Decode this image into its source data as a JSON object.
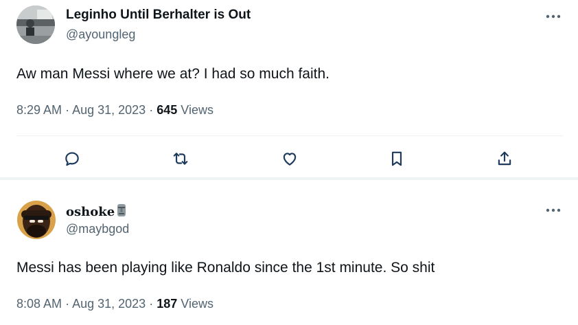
{
  "tweets": [
    {
      "author_name": "Leginho Until Berhalter is Out",
      "handle": "@ayoungleg",
      "text": "Aw man Messi where we at? I had so much faith.",
      "time": "8:29 AM",
      "date": "Aug 31, 2023",
      "views_count": "645",
      "views_label": "Views",
      "separator": "·",
      "more_icon": "more-horizontal-icon",
      "actions": [
        "reply-icon",
        "retweet-icon",
        "like-icon",
        "bookmark-icon",
        "share-icon"
      ]
    },
    {
      "author_name": "oshoke",
      "name_emoji_icon": "moai-emoji-icon",
      "handle": "@maybgod",
      "text": "Messi has been playing like Ronaldo since the 1st minute. So shit",
      "time": "8:08 AM",
      "date": "Aug 31, 2023",
      "views_count": "187",
      "views_label": "Views",
      "separator": "·",
      "more_icon": "more-horizontal-icon"
    }
  ],
  "colors": {
    "primary_text": "#0f1419",
    "secondary_text": "#536471",
    "divider": "#eff3f4",
    "icon": "#1d3a5c"
  }
}
